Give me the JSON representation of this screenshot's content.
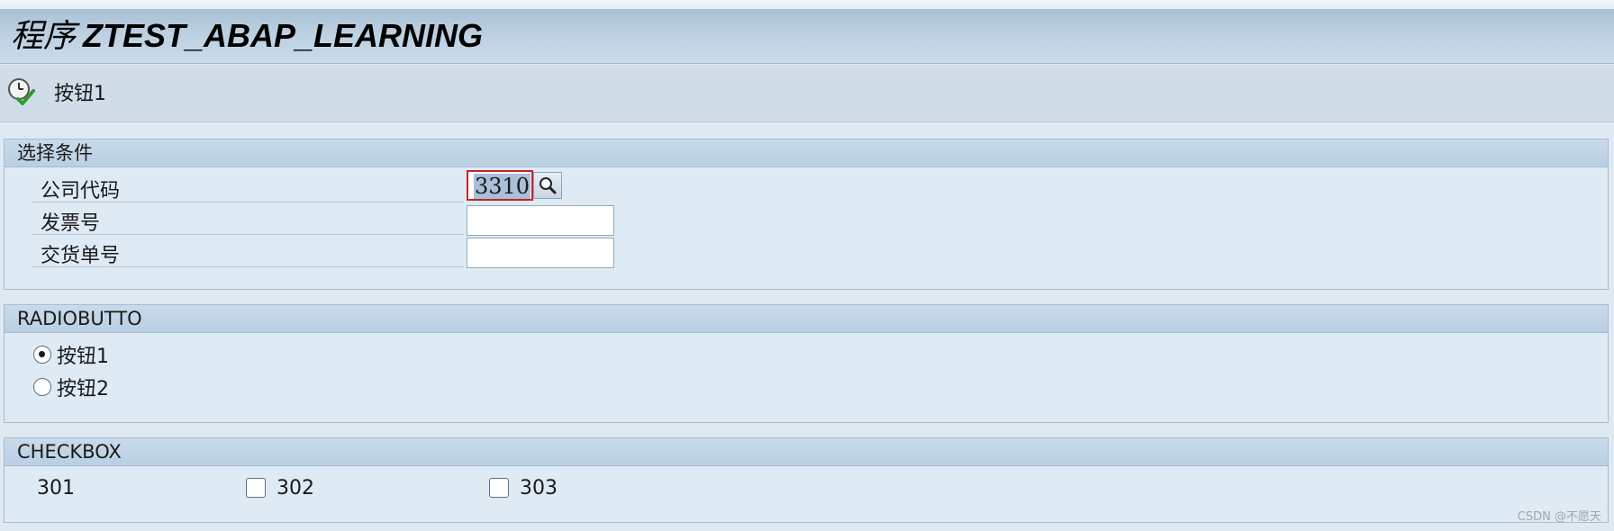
{
  "window": {
    "title_prefix": "程序",
    "title_name": "ZTEST_ABAP_LEARNING"
  },
  "toolbar": {
    "execute_label": "按钮1",
    "execute_icon": "clock-check-icon"
  },
  "selection_block": {
    "title": "选择条件",
    "fields": [
      {
        "label": "公司代码",
        "value": "3310"
      },
      {
        "label": "发票号",
        "value": ""
      },
      {
        "label": "交货单号",
        "value": ""
      }
    ]
  },
  "radio_block": {
    "title": "RADIOBUTTO",
    "options": [
      {
        "label": "按钮1",
        "checked": true
      },
      {
        "label": "按钮2",
        "checked": false
      }
    ]
  },
  "checkbox_block": {
    "title": "CHECKBOX",
    "items": [
      {
        "label": "301",
        "checked": false
      },
      {
        "label": "302",
        "checked": false
      },
      {
        "label": "303",
        "checked": false
      }
    ]
  },
  "watermark": "CSDN @不愿天",
  "colors": {
    "title_bar": "#bcd0e1",
    "toolbar": "#d0dde8",
    "group_bg": "#deeaf4",
    "group_header": "#c2d6e7",
    "required_marker": "#cc2222",
    "value_highlight": "#a9c0d9"
  }
}
